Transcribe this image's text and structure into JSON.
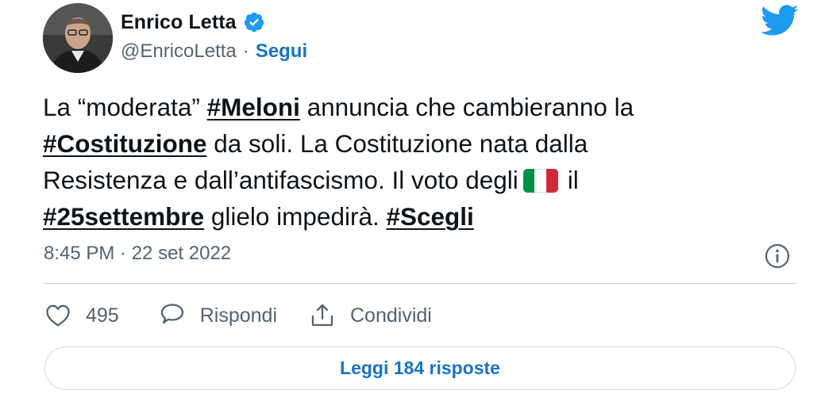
{
  "author": {
    "display_name": "Enrico Letta",
    "handle": "@EnricoLetta",
    "separator": "·",
    "follow_label": "Segui",
    "verified": true
  },
  "tweet": {
    "line1": {
      "t1": "La “moderata” ",
      "h1": "#Meloni",
      "t2": " annuncia che cambieranno la"
    },
    "line2": {
      "h1": "#Costituzione",
      "t1": " da soli. La Costituzione nata dalla"
    },
    "line3": {
      "t1": "Resistenza e dall’antifascismo. Il voto degli",
      "t2": "il",
      "flag_emoji": "italy-flag",
      "flag_colors": [
        "#009246",
        "#ffffff",
        "#ce2b37"
      ]
    },
    "line4": {
      "h1": "#25settembre",
      "t1": " glielo impedirà. ",
      "h2": "#Scegli"
    },
    "timestamp": "8:45 PM · 22 set 2022"
  },
  "actions": {
    "like_icon": "heart-icon",
    "like_count": "495",
    "reply_icon": "speech-bubble-icon",
    "reply_label": "Rispondi",
    "share_icon": "share-icon",
    "share_label": "Condividi"
  },
  "replies_button_label": "Leggi 184 risposte",
  "colors": {
    "accent": "#1d9bf0",
    "link_blue": "#1a73c7",
    "text": "#0f1419",
    "muted": "#536471",
    "border": "#cfd9de"
  }
}
